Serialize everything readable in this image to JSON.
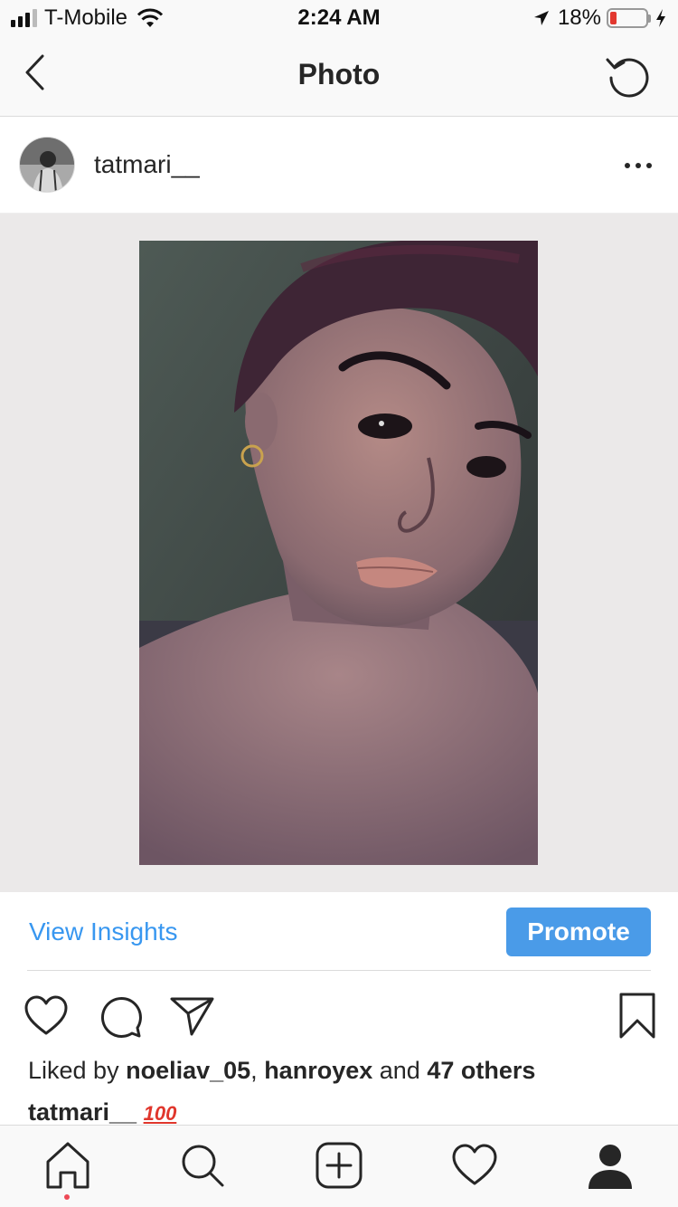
{
  "status": {
    "carrier": "T-Mobile",
    "time": "2:24 AM",
    "battery": "18%",
    "battery_level": 0.18
  },
  "nav": {
    "title": "Photo"
  },
  "post": {
    "username": "tatmari__"
  },
  "insights": {
    "view_label": "View Insights",
    "promote_label": "Promote"
  },
  "likes": {
    "prefix": "Liked by ",
    "user1": "noeliav_05",
    "sep": ", ",
    "user2": "hanroyex",
    "mid": " and ",
    "others": "47 others"
  },
  "caption": {
    "username": "tatmari__",
    "emoji": "100"
  },
  "colors": {
    "accent": "#3897f0",
    "promote": "#4a9be8",
    "notification_dot": "#ed4956"
  },
  "icons": {
    "nav": [
      "back-chevron-icon",
      "refresh-icon"
    ],
    "actions": [
      "heart-icon",
      "comment-icon",
      "share-icon",
      "bookmark-icon"
    ],
    "tabs": [
      "home-icon",
      "search-icon",
      "add-post-icon",
      "activity-heart-icon",
      "profile-icon"
    ]
  }
}
